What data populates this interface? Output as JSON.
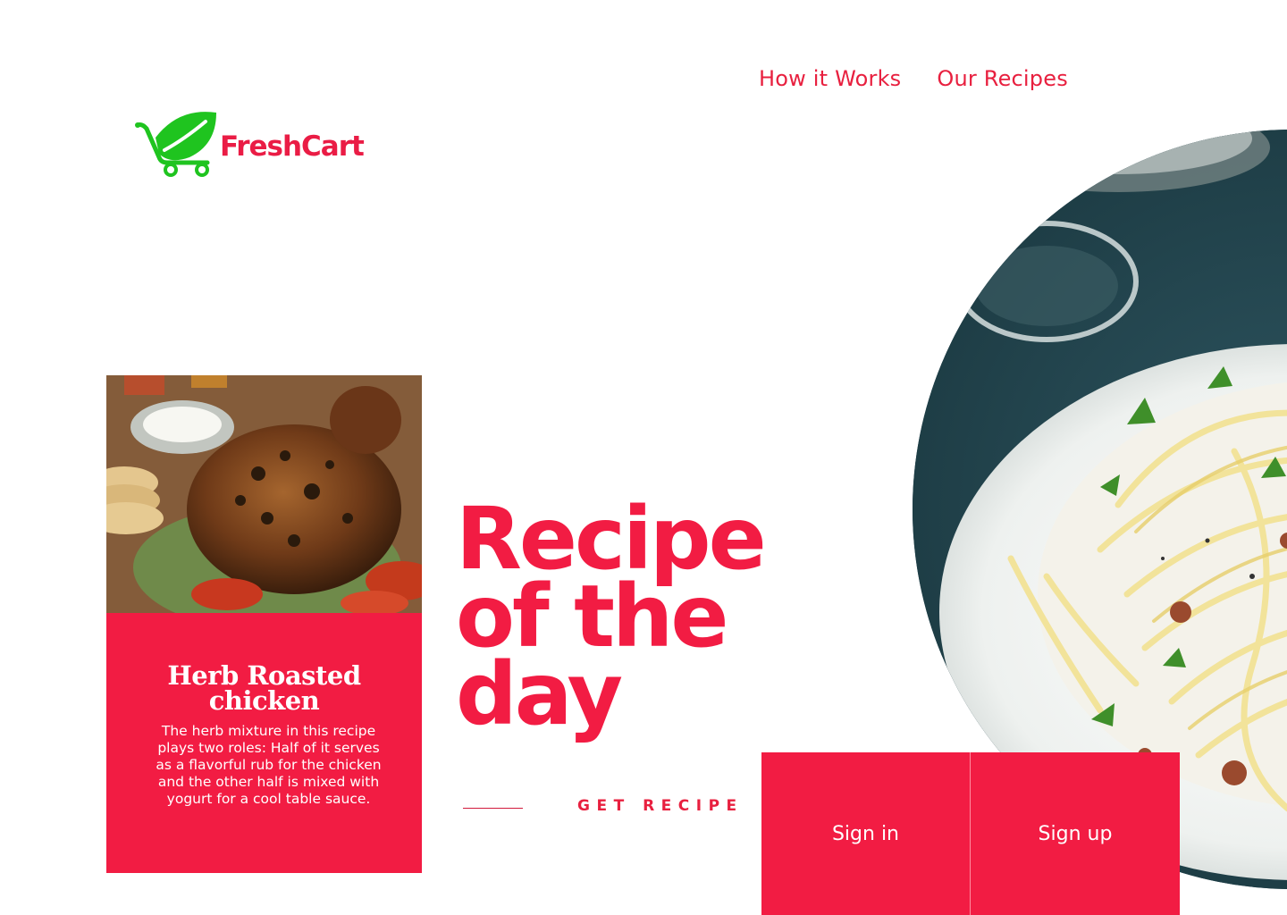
{
  "nav": {
    "items": [
      {
        "label": "How it Works"
      },
      {
        "label": "Our Recipes"
      }
    ]
  },
  "brand": {
    "name": "FreshCart",
    "logo_icon": "leaf-cart-icon",
    "logo_color": "#1fc41f",
    "text_color": "#ea1c45"
  },
  "card": {
    "title": "Herb Roasted chicken",
    "description": "The herb mixture in this recipe plays two roles: Half of it serves as a flavorful rub for the chicken and the other half is mixed with yogurt for a cool table sauce.",
    "photo": "roast-chicken-photo",
    "color": "#f21c43"
  },
  "hero": {
    "headline": "Recipe of the day",
    "cta": "GET RECIPE",
    "photo": "spaghetti-plate-photo"
  },
  "auth": {
    "sign_in": "Sign in",
    "sign_up": "Sign up"
  },
  "colors": {
    "accent": "#f21c43",
    "background": "#ffffff"
  }
}
